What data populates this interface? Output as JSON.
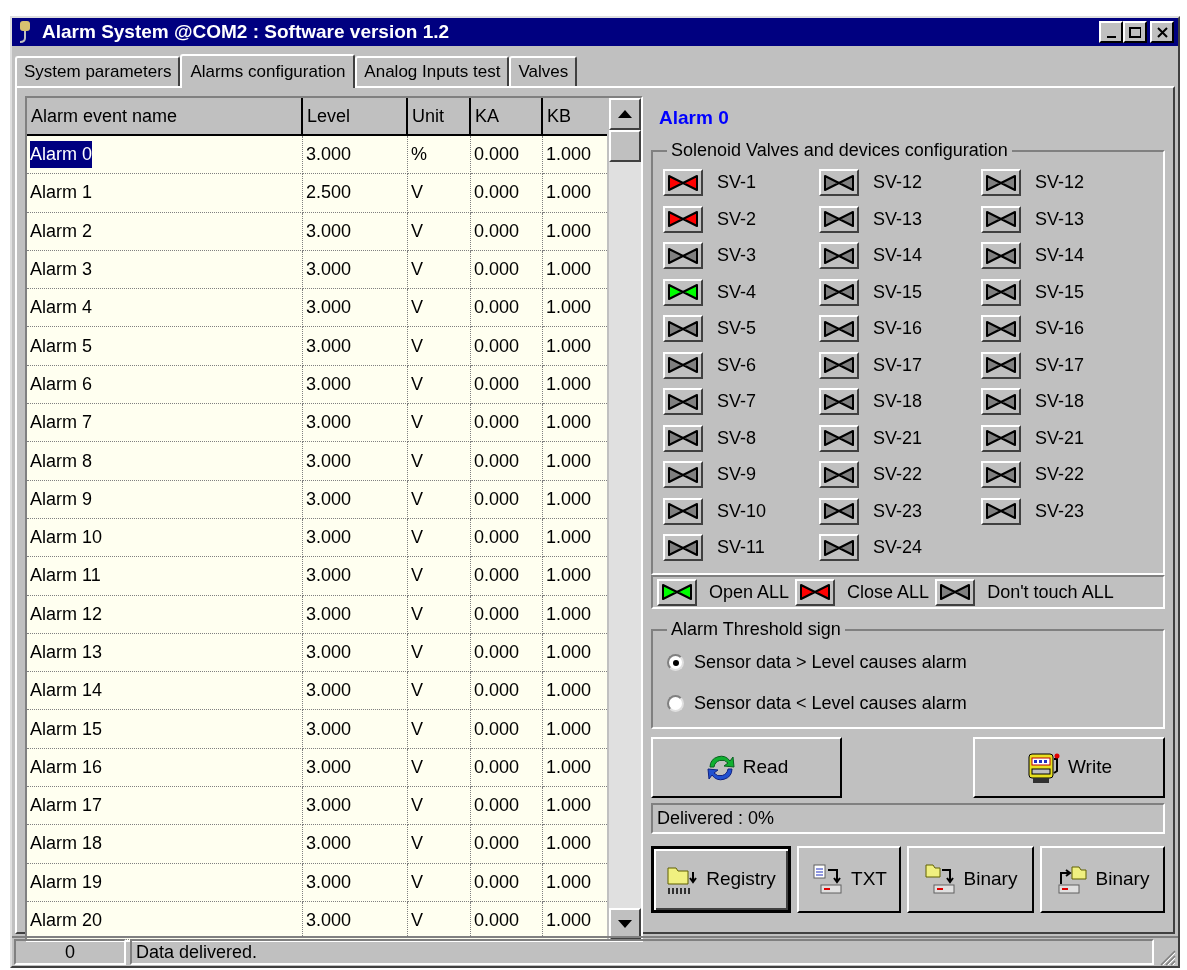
{
  "window": {
    "title": "Alarm System @COM2 : Software version 1.2"
  },
  "tabs": [
    {
      "label": "System parameters",
      "selected": false
    },
    {
      "label": "Alarms configuration",
      "selected": true
    },
    {
      "label": "Analog Inputs test",
      "selected": false
    },
    {
      "label": "Valves",
      "selected": false
    }
  ],
  "table": {
    "columns": [
      "Alarm event name",
      "Level",
      "Unit",
      "KA",
      "KB"
    ],
    "rows": [
      {
        "cells": [
          "Alarm 0",
          "3.000",
          "%",
          "0.000",
          "1.000"
        ],
        "selected": true
      },
      {
        "cells": [
          "Alarm 1",
          "2.500",
          "V",
          "0.000",
          "1.000"
        ],
        "selected": false
      },
      {
        "cells": [
          "Alarm 2",
          "3.000",
          "V",
          "0.000",
          "1.000"
        ],
        "selected": false
      },
      {
        "cells": [
          "Alarm 3",
          "3.000",
          "V",
          "0.000",
          "1.000"
        ],
        "selected": false
      },
      {
        "cells": [
          "Alarm 4",
          "3.000",
          "V",
          "0.000",
          "1.000"
        ],
        "selected": false
      },
      {
        "cells": [
          "Alarm 5",
          "3.000",
          "V",
          "0.000",
          "1.000"
        ],
        "selected": false
      },
      {
        "cells": [
          "Alarm 6",
          "3.000",
          "V",
          "0.000",
          "1.000"
        ],
        "selected": false
      },
      {
        "cells": [
          "Alarm 7",
          "3.000",
          "V",
          "0.000",
          "1.000"
        ],
        "selected": false
      },
      {
        "cells": [
          "Alarm 8",
          "3.000",
          "V",
          "0.000",
          "1.000"
        ],
        "selected": false
      },
      {
        "cells": [
          "Alarm 9",
          "3.000",
          "V",
          "0.000",
          "1.000"
        ],
        "selected": false
      },
      {
        "cells": [
          "Alarm 10",
          "3.000",
          "V",
          "0.000",
          "1.000"
        ],
        "selected": false
      },
      {
        "cells": [
          "Alarm 11",
          "3.000",
          "V",
          "0.000",
          "1.000"
        ],
        "selected": false
      },
      {
        "cells": [
          "Alarm 12",
          "3.000",
          "V",
          "0.000",
          "1.000"
        ],
        "selected": false
      },
      {
        "cells": [
          "Alarm 13",
          "3.000",
          "V",
          "0.000",
          "1.000"
        ],
        "selected": false
      },
      {
        "cells": [
          "Alarm 14",
          "3.000",
          "V",
          "0.000",
          "1.000"
        ],
        "selected": false
      },
      {
        "cells": [
          "Alarm 15",
          "3.000",
          "V",
          "0.000",
          "1.000"
        ],
        "selected": false
      },
      {
        "cells": [
          "Alarm 16",
          "3.000",
          "V",
          "0.000",
          "1.000"
        ],
        "selected": false
      },
      {
        "cells": [
          "Alarm 17",
          "3.000",
          "V",
          "0.000",
          "1.000"
        ],
        "selected": false
      },
      {
        "cells": [
          "Alarm 18",
          "3.000",
          "V",
          "0.000",
          "1.000"
        ],
        "selected": false
      },
      {
        "cells": [
          "Alarm 19",
          "3.000",
          "V",
          "0.000",
          "1.000"
        ],
        "selected": false
      },
      {
        "cells": [
          "Alarm 20",
          "3.000",
          "V",
          "0.000",
          "1.000"
        ],
        "selected": false
      }
    ]
  },
  "alarm_title": "Alarm 0",
  "valves": {
    "title": "Solenoid Valves and devices configuration",
    "columns": [
      [
        {
          "label": "SV-1",
          "color": "#ff0000"
        },
        {
          "label": "SV-2",
          "color": "#ff0000"
        },
        {
          "label": "SV-3",
          "color": "#808080"
        },
        {
          "label": "SV-4",
          "color": "#00ff00"
        },
        {
          "label": "SV-5",
          "color": "#808080"
        },
        {
          "label": "SV-6",
          "color": "#808080"
        },
        {
          "label": "SV-7",
          "color": "#808080"
        },
        {
          "label": "SV-8",
          "color": "#808080"
        },
        {
          "label": "SV-9",
          "color": "#808080"
        },
        {
          "label": "SV-10",
          "color": "#808080"
        },
        {
          "label": "SV-11",
          "color": "#808080"
        }
      ],
      [
        {
          "label": "SV-12",
          "color": "#808080"
        },
        {
          "label": "SV-13",
          "color": "#808080"
        },
        {
          "label": "SV-14",
          "color": "#808080"
        },
        {
          "label": "SV-15",
          "color": "#808080"
        },
        {
          "label": "SV-16",
          "color": "#808080"
        },
        {
          "label": "SV-17",
          "color": "#808080"
        },
        {
          "label": "SV-18",
          "color": "#808080"
        },
        {
          "label": "SV-21",
          "color": "#808080"
        },
        {
          "label": "SV-22",
          "color": "#808080"
        },
        {
          "label": "SV-23",
          "color": "#808080"
        },
        {
          "label": "SV-24",
          "color": "#808080"
        }
      ],
      [
        {
          "label": "SV-12",
          "color": "#808080"
        },
        {
          "label": "SV-13",
          "color": "#808080"
        },
        {
          "label": "SV-14",
          "color": "#808080"
        },
        {
          "label": "SV-15",
          "color": "#808080"
        },
        {
          "label": "SV-16",
          "color": "#808080"
        },
        {
          "label": "SV-17",
          "color": "#808080"
        },
        {
          "label": "SV-18",
          "color": "#808080"
        },
        {
          "label": "SV-21",
          "color": "#808080"
        },
        {
          "label": "SV-22",
          "color": "#808080"
        },
        {
          "label": "SV-23",
          "color": "#808080"
        }
      ]
    ]
  },
  "all_actions": [
    {
      "label": "Open ALL",
      "color": "#00ff00"
    },
    {
      "label": "Close ALL",
      "color": "#ff0000"
    },
    {
      "label": "Don't touch ALL",
      "color": "#808080"
    }
  ],
  "threshold": {
    "title": "Alarm Threshold sign",
    "options": [
      {
        "label": "Sensor data > Level causes alarm",
        "selected": true
      },
      {
        "label": "Sensor data < Level causes alarm",
        "selected": false
      }
    ]
  },
  "read_button": "Read",
  "write_button": "Write",
  "delivered": "Delivered : 0%",
  "file_buttons": [
    {
      "label": "Registry",
      "kind": "registry",
      "default": true
    },
    {
      "label": "TXT",
      "kind": "txt",
      "default": false
    },
    {
      "label": "Binary",
      "kind": "save",
      "default": false
    },
    {
      "label": "Binary",
      "kind": "load",
      "default": false
    }
  ],
  "status_bar": {
    "count": "0",
    "message": "Data delivered."
  }
}
